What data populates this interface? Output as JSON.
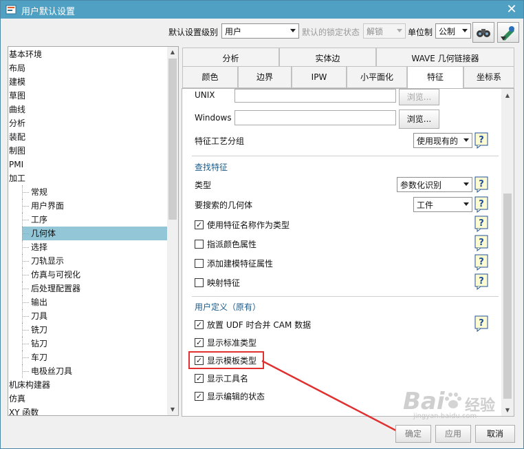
{
  "window": {
    "title": "用户默认设置",
    "close": "✕"
  },
  "toolbar": {
    "level_label": "默认设置级别",
    "level_value": "用户",
    "lock_label": "默认的锁定状态",
    "lock_value": "解锁",
    "unit_label": "单位制",
    "unit_value": "公制"
  },
  "tree": {
    "items": [
      "基本环境",
      "布局",
      "建模",
      "草图",
      "曲线",
      "分析",
      "装配",
      "制图",
      "PMI",
      "加工",
      "常规",
      "用户界面",
      "工序",
      "几何体",
      "选择",
      "刀轨显示",
      "仿真与可视化",
      "后处理配置器",
      "输出",
      "刀具",
      "铣刀",
      "钻刀",
      "车刀",
      "电极丝刀具",
      "机床构建器",
      "仿真",
      "XY 函数"
    ],
    "selected": "几何体"
  },
  "tabs": {
    "row1": [
      "分析",
      "实体边",
      "WAVE 几何链接器"
    ],
    "row2": [
      "颜色",
      "边界",
      "IPW",
      "小平面化",
      "特征",
      "坐标系"
    ],
    "active": "特征"
  },
  "panel": {
    "unix_label": "UNIX",
    "browse1": "浏览...",
    "windows_label": "Windows",
    "browse2": "浏览...",
    "group_label": "特征工艺分组",
    "group_value": "使用现有的",
    "find_title": "查找特征",
    "type_label": "类型",
    "type_value": "参数化识别",
    "geom_label": "要搜索的几何体",
    "geom_value": "工件",
    "checks1": [
      {
        "label": "使用特征名称作为类型",
        "checked": true
      },
      {
        "label": "指派颜色属性",
        "checked": false
      },
      {
        "label": "添加建模特征属性",
        "checked": false
      },
      {
        "label": "映射特征",
        "checked": false
      }
    ],
    "udf_title": "用户定义（原有）",
    "checks2": [
      {
        "label": "放置 UDF 时合并 CAM 数据",
        "checked": true
      },
      {
        "label": "显示标准类型",
        "checked": true
      },
      {
        "label": "显示模板类型",
        "checked": true
      },
      {
        "label": "显示工具名",
        "checked": true
      },
      {
        "label": "显示编辑的状态",
        "checked": true
      }
    ],
    "check_mark": "✓"
  },
  "buttons": {
    "ok": "确定",
    "apply": "应用",
    "cancel": "取消"
  },
  "watermark": {
    "main": "Bai",
    "sub": "经验",
    "url": "jingyan.baidu.com"
  },
  "colors": {
    "titlebar": "#4fa0c3",
    "selected_tree": "#93c6d6",
    "annotation_red": "#e03030",
    "section_title": "#1a5a8a"
  }
}
